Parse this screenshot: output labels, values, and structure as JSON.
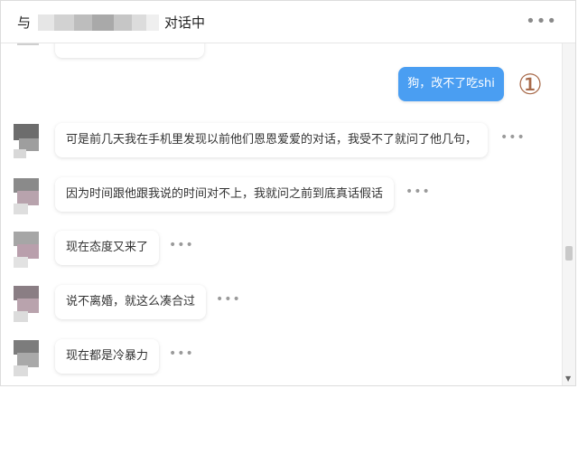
{
  "header": {
    "prefix": "与",
    "suffix": "对话中",
    "more": "•••"
  },
  "messages": {
    "outgoing": {
      "text": "狗，改不了吃shi"
    },
    "annotation": "①",
    "incoming": [
      {
        "text": "可是前几天我在手机里发现以前他们恩恩爱爱的对话，我受不了就问了他几句，",
        "more": "•••"
      },
      {
        "text": "因为时间跟他跟我说的时间对不上，我就问之前到底真话假话",
        "more": "•••"
      },
      {
        "text": "现在态度又来了",
        "more": "•••"
      },
      {
        "text": "说不离婚，就这么凑合过",
        "more": "•••"
      },
      {
        "text": "现在都是冷暴力",
        "more": "•••"
      }
    ]
  },
  "colors": {
    "accent": "#4a9ef2",
    "annotation": "#a86a4a"
  }
}
